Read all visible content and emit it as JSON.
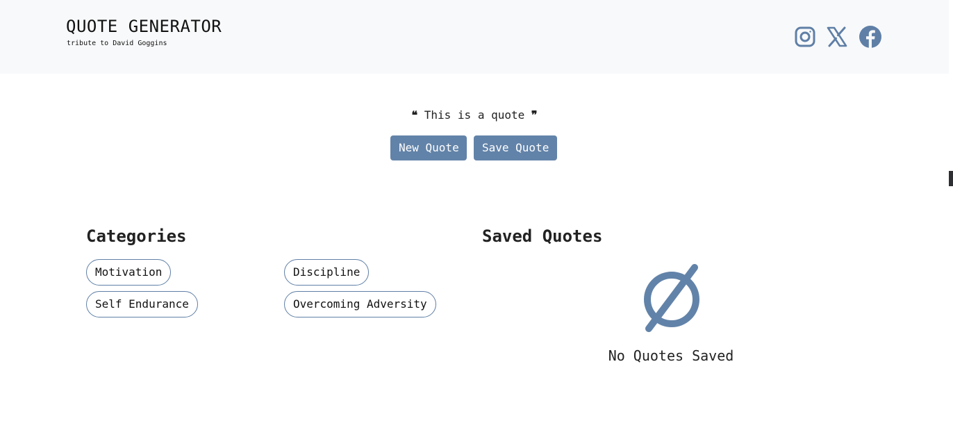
{
  "header": {
    "title": "QUOTE GENERATOR",
    "subtitle": "tribute to David Goggins",
    "social_icons": [
      "instagram-icon",
      "x-icon",
      "facebook-icon"
    ]
  },
  "quote": {
    "open_mark": "❝",
    "text": "This is a quote",
    "close_mark": "❞"
  },
  "actions": {
    "new_quote_label": "New Quote",
    "save_quote_label": "Save Quote"
  },
  "categories": {
    "heading": "Categories",
    "items": [
      "Motivation",
      "Discipline",
      "Self Endurance",
      "Overcoming Adversity"
    ]
  },
  "saved": {
    "heading": "Saved Quotes",
    "empty_icon": "empty-set-icon",
    "empty_text": "No Quotes Saved"
  },
  "colors": {
    "accent": "#6283a9",
    "header_bg": "#f8f9fa",
    "text": "#1f1f1f"
  }
}
